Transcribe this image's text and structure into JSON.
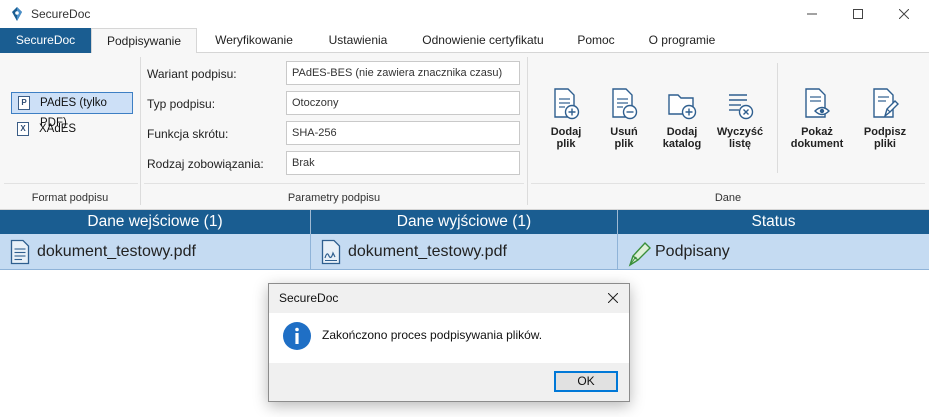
{
  "window": {
    "title": "SecureDoc"
  },
  "menu": {
    "tabs": [
      "SecureDoc",
      "Podpisywanie",
      "Weryfikowanie",
      "Ustawienia",
      "Odnowienie certyfikatu",
      "Pomoc",
      "O programie"
    ]
  },
  "ribbon": {
    "format_group": {
      "label": "Format podpisu",
      "options": [
        {
          "label": "PAdES (tylko PDF)",
          "icon": "P",
          "selected": true
        },
        {
          "label": "XAdES",
          "icon": "X",
          "selected": false
        }
      ]
    },
    "params_group": {
      "label": "Parametry podpisu",
      "rows": [
        {
          "label": "Wariant podpisu:",
          "value": "PAdES-BES (nie zawiera znacznika czasu)"
        },
        {
          "label": "Typ podpisu:",
          "value": "Otoczony"
        },
        {
          "label": "Funkcja skrótu:",
          "value": "SHA-256"
        },
        {
          "label": "Rodzaj zobowiązania:",
          "value": "Brak"
        }
      ]
    },
    "data_group": {
      "label": "Dane",
      "buttons": [
        {
          "line1": "Dodaj",
          "line2": "plik"
        },
        {
          "line1": "Usuń",
          "line2": "plik"
        },
        {
          "line1": "Dodaj",
          "line2": "katalog"
        },
        {
          "line1": "Wyczyść",
          "line2": "listę"
        },
        {
          "line1": "Pokaż",
          "line2": "dokument"
        },
        {
          "line1": "Podpisz",
          "line2": "pliki"
        }
      ]
    }
  },
  "table": {
    "headers": [
      "Dane wejściowe (1)",
      "Dane wyjściowe (1)",
      "Status"
    ],
    "rows": [
      {
        "input": "dokument_testowy.pdf",
        "output": "dokument_testowy.pdf",
        "status": "Podpisany"
      }
    ]
  },
  "dialog": {
    "title": "SecureDoc",
    "message": "Zakończono proces podpisywania plików.",
    "ok_label": "OK"
  },
  "colors": {
    "accent": "#1a5d91",
    "row_selected": "#c5dbf2",
    "ribbon_bg": "#f7f7f7"
  }
}
